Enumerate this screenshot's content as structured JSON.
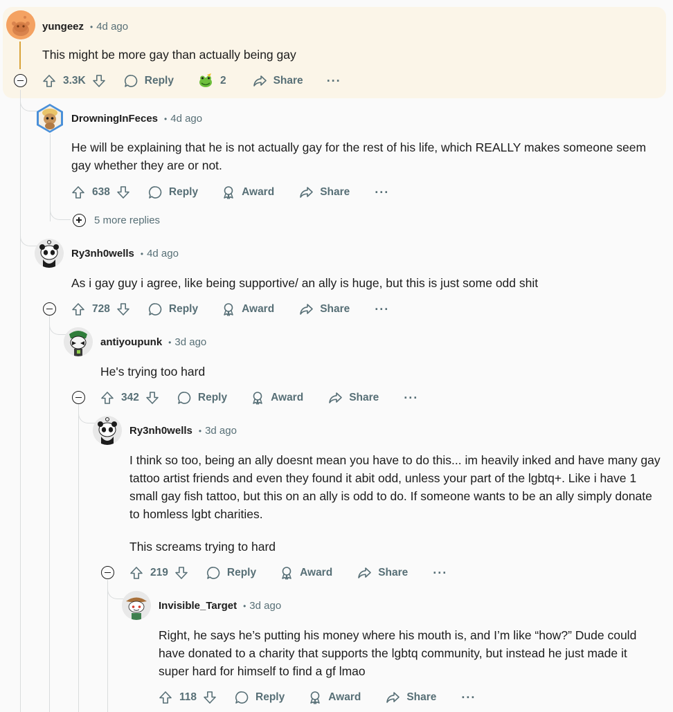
{
  "colors": {
    "accent_gold": "#d9a33a",
    "highlight_bg": "#fbf5e8",
    "meta_text": "#576f76",
    "thread_line": "#d9dcdd"
  },
  "labels": {
    "reply": "Reply",
    "award": "Award",
    "share": "Share",
    "more": "···"
  },
  "comments": [
    {
      "username": "yungeez",
      "time": "4d ago",
      "body": [
        "This might be more gay than actually being gay"
      ],
      "votes": "3.3K",
      "award_count": "2",
      "avatar_icon": "reddit-snoo-default-icon"
    },
    {
      "username": "DrowningInFeces",
      "time": "4d ago",
      "body": [
        "He will be explaining that he is not actually gay for the rest of his life, which REALLY makes someone seem gay whether they are or not."
      ],
      "votes": "638",
      "more_replies": "5 more replies",
      "avatar_icon": "custom-snoo-avatar"
    },
    {
      "username": "Ry3nh0wells",
      "time": "4d ago",
      "body": [
        "As i gay guy i agree, like being supportive/ an ally is huge, but this is just some odd shit"
      ],
      "votes": "728",
      "avatar_icon": "panda-snoo-avatar"
    },
    {
      "username": "antiyoupunk",
      "time": "3d ago",
      "body": [
        "He's trying too hard"
      ],
      "votes": "342",
      "avatar_icon": "masked-snoo-avatar"
    },
    {
      "username": "Ry3nh0wells",
      "time": "3d ago",
      "body": [
        "I think so too, being an ally doesnt mean you have to do this... im heavily inked and have many gay tattoo artist friends and even they found it abit odd, unless your part of the lgbtq+. Like i have 1 small gay fish tattoo, but this on an ally is odd to do. If someone wants to be an ally simply donate to homless lgbt charities.",
        "This screams trying to hard"
      ],
      "votes": "219",
      "avatar_icon": "panda-snoo-avatar"
    },
    {
      "username": "Invisible_Target",
      "time": "3d ago",
      "body": [
        "Right, he says he’s putting his money where his mouth is, and I’m like “how?” Dude could have donated to a charity that supports the lgbtq community, but instead he just made it super hard for himself to find a gf lmao"
      ],
      "votes": "118",
      "avatar_icon": "cowboy-snoo-avatar"
    }
  ]
}
